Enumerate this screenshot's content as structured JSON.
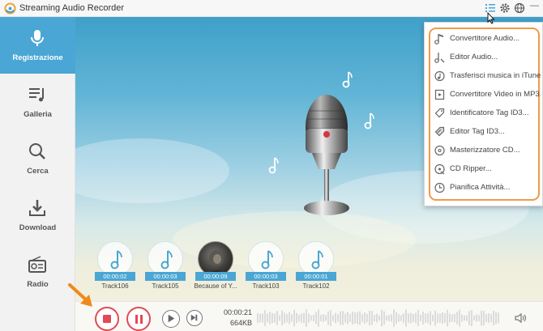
{
  "app": {
    "title": "Streaming Audio Recorder"
  },
  "sidebar": {
    "items": [
      {
        "label": "Registrazione",
        "icon": "microphone-icon",
        "active": true
      },
      {
        "label": "Galleria",
        "icon": "playlist-icon",
        "active": false
      },
      {
        "label": "Cerca",
        "icon": "search-icon",
        "active": false
      },
      {
        "label": "Download",
        "icon": "download-icon",
        "active": false
      },
      {
        "label": "Radio",
        "icon": "radio-icon",
        "active": false
      }
    ]
  },
  "tracks": [
    {
      "time": "00:00:02",
      "name": "Track106"
    },
    {
      "time": "00:00:03",
      "name": "Track105"
    },
    {
      "time": "00:00:09",
      "name": "Because of Y..."
    },
    {
      "time": "00:00:03",
      "name": "Track103"
    },
    {
      "time": "00:00:01",
      "name": "Track102"
    }
  ],
  "player": {
    "elapsed": "00:00:21",
    "size": "664KB"
  },
  "menu": {
    "items": [
      {
        "label": "Convertitore Audio...",
        "icon": "music-note-icon"
      },
      {
        "label": "Editor Audio...",
        "icon": "audio-editor-icon"
      },
      {
        "label": "Trasferisci musica in iTunes...",
        "icon": "itunes-transfer-icon"
      },
      {
        "label": "Convertitore Video in MP3...",
        "icon": "video-converter-icon"
      },
      {
        "label": "Identificatore Tag ID3...",
        "icon": "tag-icon"
      },
      {
        "label": "Editor Tag ID3...",
        "icon": "tag-edit-icon"
      },
      {
        "label": "Masterizzatore CD...",
        "icon": "cd-burn-icon"
      },
      {
        "label": "CD Ripper...",
        "icon": "cd-ripper-icon"
      },
      {
        "label": "Pianifica Attività...",
        "icon": "clock-icon"
      }
    ]
  },
  "colors": {
    "accent": "#4aa6d4",
    "record": "#e14a56",
    "highlight": "#ee9a4b"
  }
}
